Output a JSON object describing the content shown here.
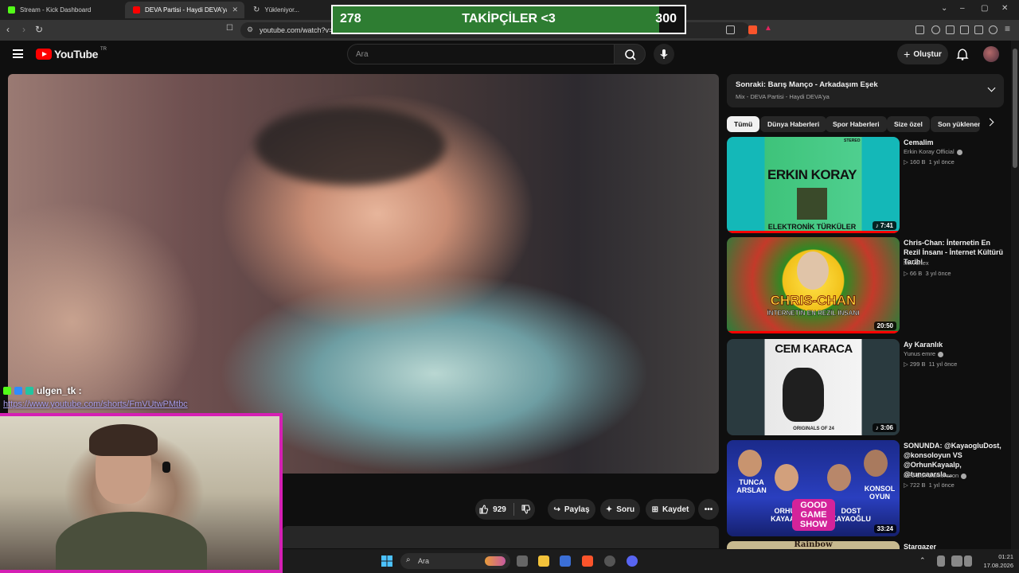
{
  "browser": {
    "tabs": [
      {
        "title": "Stream - Kick Dashboard",
        "active": false
      },
      {
        "title": "DEVA Partisi - Haydi DEVA'ya - Y",
        "active": true
      },
      {
        "title": "Yükleniyor...",
        "active": false
      }
    ],
    "url": "youtube.com/watch?v="
  },
  "overlay": {
    "current": "278",
    "label": "TAKİPÇİLER <3",
    "goal": "300",
    "progress_fraction": 0.927
  },
  "youtube": {
    "logo_text": "YouTube",
    "region": "TR",
    "search_placeholder": "Ara",
    "create_label": "Oluştur"
  },
  "actions": {
    "likes": "929",
    "share": "Paylaş",
    "ask": "Soru",
    "save": "Kaydet"
  },
  "chat": {
    "username": "ulgen_tk :",
    "message": "https://www.youtube.com/shorts/FmVUtwPMtbc"
  },
  "up_next": {
    "title": "Sonraki: Barış Manço - Arkadaşım Eşek",
    "subtitle": "Mix - DEVA Partisi - Haydi DEVA'ya"
  },
  "chips": [
    "Tümü",
    "Dünya Haberleri",
    "Spor Haberleri",
    "Size özel",
    "Son yüklenen"
  ],
  "recommendations": [
    {
      "title": "Cemalim",
      "channel": "Erkin Koray Official",
      "verified": true,
      "views": "160 B",
      "age": "1 yıl önce",
      "duration": "7:41",
      "music": true,
      "thumb_text": "ERKIN KORAY",
      "thumb_sub": "ELEKTRONİK TÜRKÜLER",
      "stereo": "STEREO",
      "progress": 1.0
    },
    {
      "title": "Chris-Chan: İnternetin En Rezil İnsanı - İnternet Kültürü Tarihi",
      "channel": "Mr.Vortex",
      "verified": false,
      "views": "66 B",
      "age": "3 yıl önce",
      "duration": "20:50",
      "music": false,
      "thumb_text": "CHRIS-CHAN",
      "thumb_sub": "İNTERNETİN EN REZİL İNSANI",
      "progress": 1.0
    },
    {
      "title": "Ay Karanlık",
      "channel": "Yunus emre",
      "verified": true,
      "views": "299 B",
      "age": "11 yıl önce",
      "duration": "3:06",
      "music": true,
      "thumb_text": "CEM KARACA",
      "thumb_sub": "ORIGINALS OF 24",
      "progress": 0
    },
    {
      "title": "SONUNDA: @KayaogluDost, @konsoloyun VS @OrhunKayaalp, @tuncaarsla...",
      "channel": "Red Bull Gamerszon",
      "verified": true,
      "views": "722 B",
      "age": "1 yıl önce",
      "duration": "33:24",
      "music": false,
      "thumb_text": "GOOD GAME SHOW",
      "thumb_names": [
        "TUNCA ARSLAN",
        "ORHUN KAYAALP",
        "DOST KAYAOĞLU",
        "KONSOL OYUN"
      ],
      "progress": 0
    },
    {
      "title": "Stargazer",
      "channel": "",
      "verified": false,
      "views": "",
      "age": "",
      "duration": "",
      "music": false,
      "thumb_text": "Rainbow",
      "progress": 0
    }
  ],
  "taskbar": {
    "search_placeholder": "Ara",
    "time": "01:21",
    "date": "17.08.2026"
  },
  "colors": {
    "overlay_fill": "#2e7d32",
    "webcam_border": "#d51fb4",
    "yt_red": "#ff0000",
    "chat_link": "#a59be8"
  }
}
